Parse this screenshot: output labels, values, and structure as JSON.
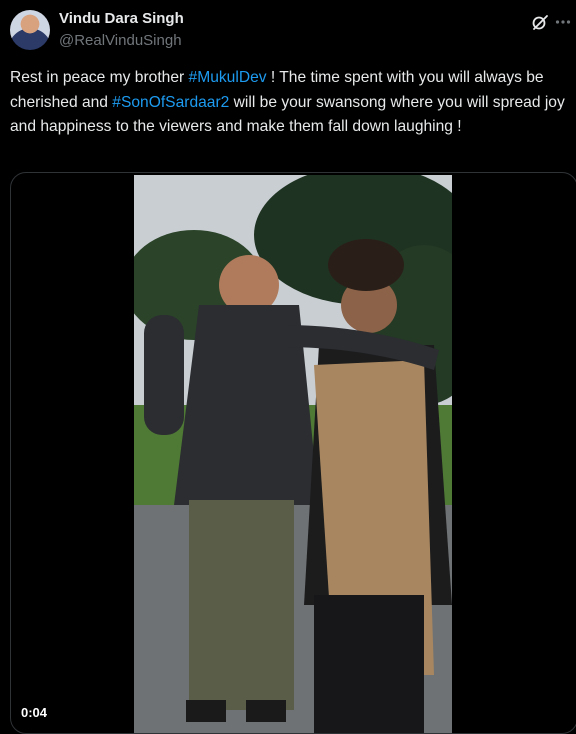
{
  "author": {
    "name": "Vindu Dara Singh",
    "handle": "@RealVinduSingh"
  },
  "icons": {
    "avatar": "profile-avatar",
    "grok": "grok-icon",
    "more": "more-dots-icon"
  },
  "tweet": {
    "t1": "Rest in peace my brother ",
    "tag1": "#MukulDev",
    "t2": " ! The time spent with you will always be cherished and ",
    "tag2": "#SonOfSardaar2",
    "t3": " will be your swansong where you will spread joy and happiness to the viewers and make them fall down laughing !"
  },
  "video": {
    "timestamp": "0:04"
  },
  "colors": {
    "background": "#000000",
    "text": "#e7e9ea",
    "secondary": "#71767b",
    "link": "#1d9bf0",
    "border": "#2f3336"
  }
}
